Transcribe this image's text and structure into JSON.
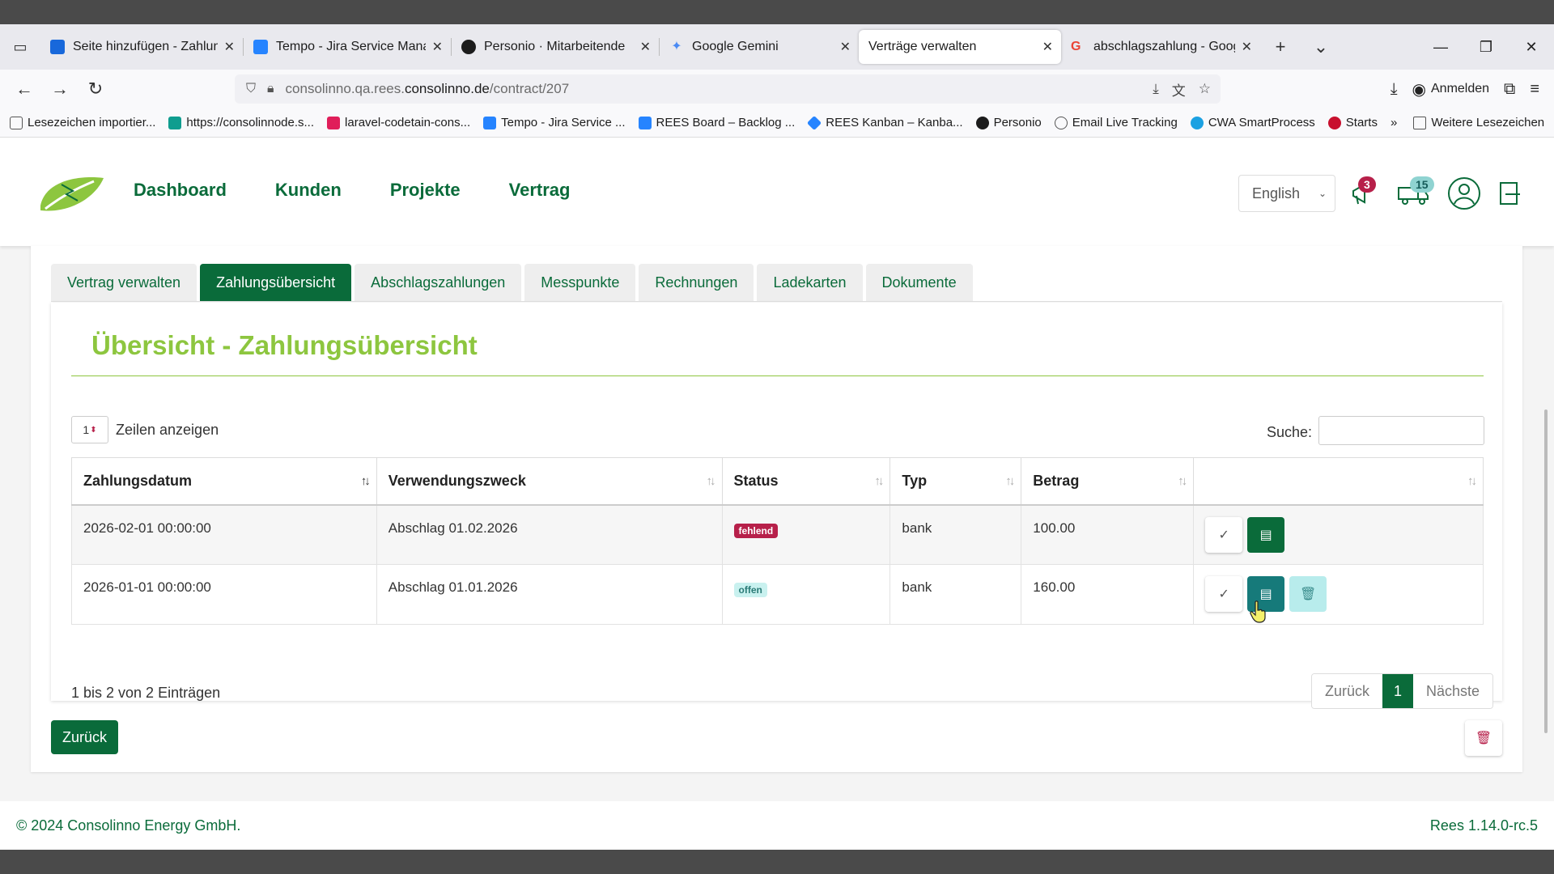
{
  "browser": {
    "tabs": [
      {
        "title": "Seite hinzufügen - Zahlungs",
        "color": "#1868db"
      },
      {
        "title": "Tempo - Jira Service Manag",
        "color": "#2684ff"
      },
      {
        "title": "Personio · Mitarbeitende",
        "color": "#1c1c1c"
      },
      {
        "title": "Google Gemini",
        "color": "#4a8af4"
      },
      {
        "title": "Verträge verwalten",
        "color": "#ffffff"
      },
      {
        "title": "abschlagszahlung - Google",
        "color": "#ea4335"
      }
    ],
    "url": {
      "prefix": "consolinno.qa.rees.",
      "host": "consolinno.de",
      "path": "/contract/207"
    },
    "signin_label": "Anmelden",
    "bookmarks": [
      {
        "label": "Lesezeichen importier...",
        "color": "#555555"
      },
      {
        "label": "https://consolinnode.s...",
        "color": "#0f9d8f"
      },
      {
        "label": "laravel-codetain-cons...",
        "color": "#e01e5a"
      },
      {
        "label": "Tempo - Jira Service ...",
        "color": "#2684ff"
      },
      {
        "label": "REES Board – Backlog ...",
        "color": "#2684ff"
      },
      {
        "label": "REES Kanban – Kanba...",
        "color": "#2684ff"
      },
      {
        "label": "Personio",
        "color": "#1c1c1c"
      },
      {
        "label": "Email Live Tracking",
        "color": "#555555"
      },
      {
        "label": "CWA SmartProcess",
        "color": "#1ba1e2"
      },
      {
        "label": "Starts",
        "color": "#c8102e"
      }
    ],
    "more_bookmarks_label": "Weitere Lesezeichen"
  },
  "app": {
    "nav": [
      "Dashboard",
      "Kunden",
      "Projekte",
      "Vertrag"
    ],
    "language": "English",
    "notifications_count": "3",
    "messages_count": "15",
    "tabs": [
      "Vertrag verwalten",
      "Zahlungsübersicht",
      "Abschlagszahlungen",
      "Messpunkte",
      "Rechnungen",
      "Ladekarten",
      "Dokumente"
    ],
    "active_tab": 1,
    "panel_title": "Übersicht - Zahlungsübersicht",
    "length_value": "1",
    "length_label": "Zeilen anzeigen",
    "search_label": "Suche:",
    "table": {
      "headers": [
        "Zahlungsdatum",
        "Verwendungszweck",
        "Status",
        "Typ",
        "Betrag",
        ""
      ],
      "rows": [
        {
          "date": "2026-02-01 00:00:00",
          "purpose": "Abschlag 01.02.2026",
          "status": "fehlend",
          "type": "bank",
          "amount": "100.00"
        },
        {
          "date": "2026-01-01 00:00:00",
          "purpose": "Abschlag 01.01.2026",
          "status": "offen",
          "type": "bank",
          "amount": "160.00"
        }
      ]
    },
    "info": "1 bis 2 von 2 Einträgen",
    "pager": {
      "prev": "Zurück",
      "current": "1",
      "next": "Nächste"
    },
    "back_label": "Zurück",
    "footer_left": "© 2024 Consolinno Energy GmbH.",
    "footer_right": "Rees 1.14.0-rc.5"
  },
  "colors": {
    "primary_green": "#0a6b3a",
    "title_green": "#8dc63f",
    "status_missing": "#b7204a",
    "status_open": "#c9f1ef",
    "action_teal": "#167a7a"
  }
}
